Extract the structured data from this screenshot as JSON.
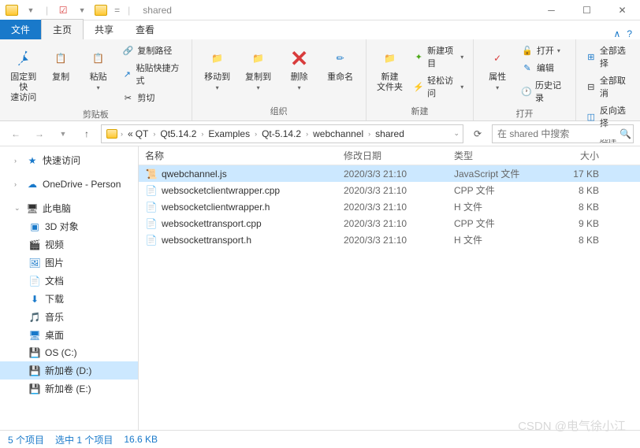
{
  "title": "shared",
  "tabs": {
    "file": "文件",
    "home": "主页",
    "share": "共享",
    "view": "查看"
  },
  "ribbon": {
    "clipboard": {
      "pin": "固定到快\n速访问",
      "copy": "复制",
      "paste": "粘贴",
      "copy_path": "复制路径",
      "paste_shortcut": "粘贴快捷方式",
      "cut": "剪切",
      "label": "剪贴板"
    },
    "organize": {
      "move": "移动到",
      "copyto": "复制到",
      "delete": "删除",
      "rename": "重命名",
      "label": "组织"
    },
    "new": {
      "folder": "新建\n文件夹",
      "new_item": "新建项目",
      "easy_access": "轻松访问",
      "label": "新建"
    },
    "open": {
      "properties": "属性",
      "open": "打开",
      "edit": "编辑",
      "history": "历史记录",
      "label": "打开"
    },
    "select": {
      "all": "全部选择",
      "none": "全部取消",
      "invert": "反向选择",
      "label": "选择"
    }
  },
  "breadcrumb": [
    "QT",
    "Qt5.14.2",
    "Examples",
    "Qt-5.14.2",
    "webchannel",
    "shared"
  ],
  "search_placeholder": "在 shared 中搜索",
  "sidebar": {
    "quick": "快速访问",
    "onedrive": "OneDrive - Person",
    "thispc": "此电脑",
    "items": [
      "3D 对象",
      "视频",
      "图片",
      "文档",
      "下载",
      "音乐",
      "桌面",
      "OS (C:)",
      "新加卷 (D:)",
      "新加卷 (E:)"
    ]
  },
  "columns": {
    "name": "名称",
    "date": "修改日期",
    "type": "类型",
    "size": "大小"
  },
  "files": [
    {
      "name": "qwebchannel.js",
      "date": "2020/3/3 21:10",
      "type": "JavaScript 文件",
      "size": "17 KB",
      "icon": "js",
      "selected": true
    },
    {
      "name": "websocketclientwrapper.cpp",
      "date": "2020/3/3 21:10",
      "type": "CPP 文件",
      "size": "8 KB",
      "icon": "cpp"
    },
    {
      "name": "websocketclientwrapper.h",
      "date": "2020/3/3 21:10",
      "type": "H 文件",
      "size": "8 KB",
      "icon": "h"
    },
    {
      "name": "websockettransport.cpp",
      "date": "2020/3/3 21:10",
      "type": "CPP 文件",
      "size": "9 KB",
      "icon": "cpp"
    },
    {
      "name": "websockettransport.h",
      "date": "2020/3/3 21:10",
      "type": "H 文件",
      "size": "8 KB",
      "icon": "h"
    }
  ],
  "status": {
    "count": "5 个项目",
    "selected": "选中 1 个项目",
    "size": "16.6 KB"
  },
  "watermark": "CSDN @电气徐小江"
}
